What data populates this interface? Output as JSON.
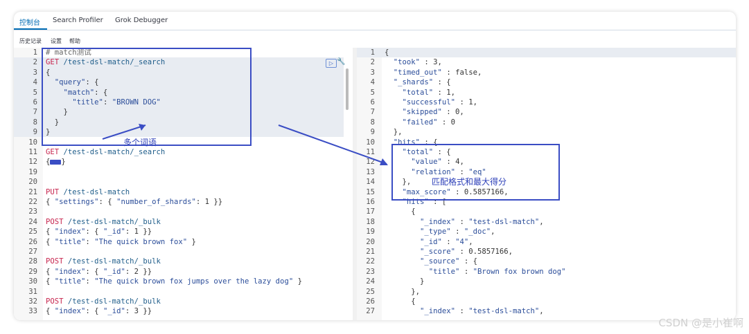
{
  "tabs": [
    "控制台",
    "Search Profiler",
    "Grok Debugger"
  ],
  "menu": [
    "历史记录",
    "设置",
    "帮助"
  ],
  "left_lines": [
    {
      "n": "1",
      "t": "# match测试"
    },
    {
      "n": "2",
      "t": "GET /test-dsl-match/_search"
    },
    {
      "n": "3",
      "t": "{"
    },
    {
      "n": "4",
      "t": "  \"query\": {"
    },
    {
      "n": "5",
      "t": "    \"match\": {"
    },
    {
      "n": "6",
      "t": "      \"title\": \"BROWN DOG\""
    },
    {
      "n": "7",
      "t": "    }"
    },
    {
      "n": "8",
      "t": "  }"
    },
    {
      "n": "9",
      "t": "}"
    },
    {
      "n": "10",
      "t": ""
    },
    {
      "n": "11",
      "t": "GET /test-dsl-match/_search"
    },
    {
      "n": "12",
      "t": "{"
    },
    {
      "n": "19",
      "t": ""
    },
    {
      "n": "20",
      "t": ""
    },
    {
      "n": "21",
      "t": "PUT /test-dsl-match"
    },
    {
      "n": "22",
      "t": "{ \"settings\": { \"number_of_shards\": 1 }}"
    },
    {
      "n": "23",
      "t": ""
    },
    {
      "n": "24",
      "t": "POST /test-dsl-match/_bulk"
    },
    {
      "n": "25",
      "t": "{ \"index\": { \"_id\": 1 }}"
    },
    {
      "n": "26",
      "t": "{ \"title\": \"The quick brown fox\" }"
    },
    {
      "n": "27",
      "t": ""
    },
    {
      "n": "28",
      "t": "POST /test-dsl-match/_bulk"
    },
    {
      "n": "29",
      "t": "{ \"index\": { \"_id\": 2 }}"
    },
    {
      "n": "30",
      "t": "{ \"title\": \"The quick brown fox jumps over the lazy dog\" }"
    },
    {
      "n": "31",
      "t": ""
    },
    {
      "n": "32",
      "t": "POST /test-dsl-match/_bulk"
    },
    {
      "n": "33",
      "t": "{ \"index\": { \"_id\": 3 }}"
    }
  ],
  "right_lines": [
    {
      "n": "1",
      "t": "{"
    },
    {
      "n": "2",
      "t": "  \"took\" : 3,"
    },
    {
      "n": "3",
      "t": "  \"timed_out\" : false,"
    },
    {
      "n": "4",
      "t": "  \"_shards\" : {"
    },
    {
      "n": "5",
      "t": "    \"total\" : 1,"
    },
    {
      "n": "6",
      "t": "    \"successful\" : 1,"
    },
    {
      "n": "7",
      "t": "    \"skipped\" : 0,"
    },
    {
      "n": "8",
      "t": "    \"failed\" : 0"
    },
    {
      "n": "9",
      "t": "  },"
    },
    {
      "n": "10",
      "t": "  \"hits\" : {"
    },
    {
      "n": "11",
      "t": "    \"total\" : {"
    },
    {
      "n": "12",
      "t": "      \"value\" : 4,"
    },
    {
      "n": "13",
      "t": "      \"relation\" : \"eq\""
    },
    {
      "n": "14",
      "t": "    },"
    },
    {
      "n": "15",
      "t": "    \"max_score\" : 0.5857166,"
    },
    {
      "n": "16",
      "t": "    \"hits\" : ["
    },
    {
      "n": "17",
      "t": "      {"
    },
    {
      "n": "18",
      "t": "        \"_index\" : \"test-dsl-match\","
    },
    {
      "n": "19",
      "t": "        \"_type\" : \"_doc\","
    },
    {
      "n": "20",
      "t": "        \"_id\" : \"4\","
    },
    {
      "n": "21",
      "t": "        \"_score\" : 0.5857166,"
    },
    {
      "n": "22",
      "t": "        \"_source\" : {"
    },
    {
      "n": "23",
      "t": "          \"title\" : \"Brown fox brown dog\""
    },
    {
      "n": "24",
      "t": "        }"
    },
    {
      "n": "25",
      "t": "      },"
    },
    {
      "n": "26",
      "t": "      {"
    },
    {
      "n": "27",
      "t": "        \"_index\" : \"test-dsl-match\","
    }
  ],
  "annotations": {
    "left": "多个词语",
    "right": "匹配格式和最大得分"
  },
  "watermark": "CSDN @是小崔啊"
}
